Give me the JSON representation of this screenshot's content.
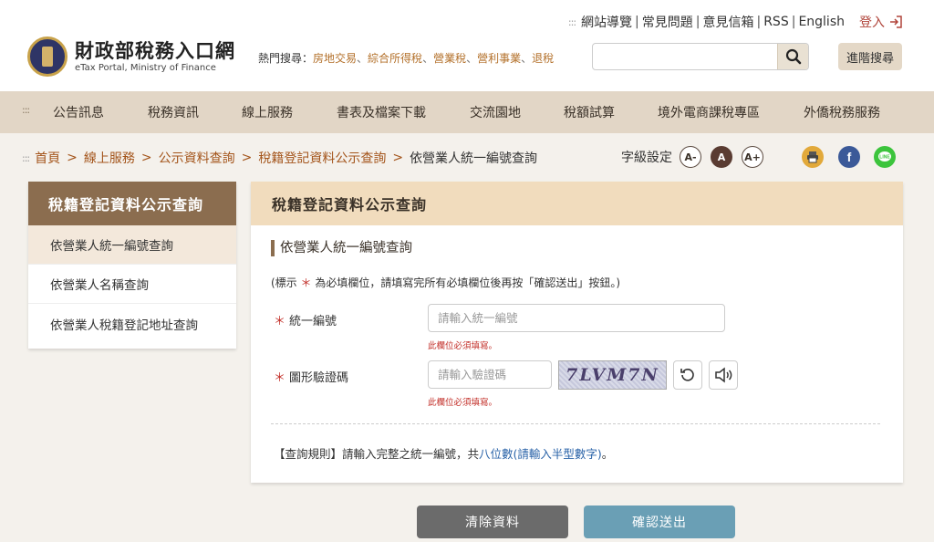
{
  "header": {
    "top_links": [
      "網站導覽",
      "常見問題",
      "意見信箱",
      "RSS",
      "English"
    ],
    "login": "登入",
    "logo_zh": "財政部稅務入口網",
    "logo_en": "eTax Portal, Ministry of Finance",
    "hot_label": "熱門搜尋：",
    "hot_keywords": [
      "房地交易",
      "綜合所得稅",
      "營業稅",
      "營利事業",
      "退稅"
    ],
    "advanced_search": "進階搜尋"
  },
  "nav": [
    "公告訊息",
    "稅務資訊",
    "線上服務",
    "書表及檔案下載",
    "交流園地",
    "稅額試算",
    "境外電商課稅專區",
    "外僑稅務服務"
  ],
  "breadcrumb": {
    "items": [
      "首頁",
      "線上服務",
      "公示資料查詢",
      "稅籍登記資料公示查詢"
    ],
    "current": "依營業人統一編號查詢"
  },
  "font_setting": {
    "label": "字級設定",
    "small": "A-",
    "medium": "A",
    "large": "A+"
  },
  "sidebar": {
    "title": "稅籍登記資料公示查詢",
    "items": [
      "依營業人統一編號查詢",
      "依營業人名稱查詢",
      "依營業人稅籍登記地址查詢"
    ]
  },
  "panel": {
    "title": "稅籍登記資料公示查詢",
    "subtitle": "依營業人統一編號查詢",
    "note_prefix": "(標示",
    "note_star": "＊",
    "note_suffix": "為必填欄位，請填寫完所有必填欄位後再按「確認送出」按鈕。)",
    "fields": {
      "ban_label": "統一編號",
      "ban_placeholder": "請輸入統一編號",
      "ban_error": "此欄位必須填寫。",
      "captcha_label": "圖形驗證碼",
      "captcha_placeholder": "請輸入驗證碼",
      "captcha_error": "此欄位必須填寫。",
      "captcha_text": "7LVM7N"
    },
    "rule_prefix": "【查詢規則】請輸入完整之統一編號，共",
    "rule_highlight": "八位數(請輸入半型數字)",
    "rule_suffix": "。"
  },
  "buttons": {
    "clear": "清除資料",
    "submit": "確認送出"
  },
  "colors": {
    "nav_bg": "#e2d6c6",
    "sidebar_head": "#8b6d4f",
    "panel_head": "#f1dcbd",
    "link": "#a3541a",
    "required": "#c3302a",
    "submit": "#6a9fb5",
    "clear": "#6b6b6b"
  }
}
